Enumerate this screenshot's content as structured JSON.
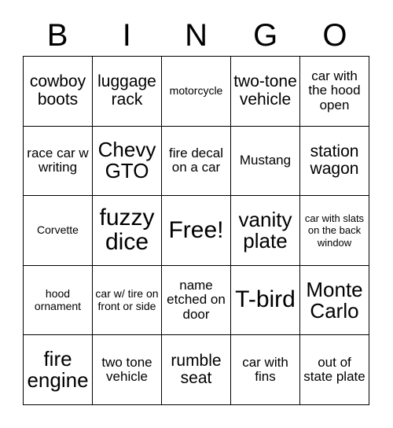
{
  "header": {
    "letters": [
      "B",
      "I",
      "N",
      "G",
      "O"
    ]
  },
  "grid": {
    "rows": 5,
    "columns": 5,
    "free_space_label": "Free!",
    "cells": [
      {
        "text": "cowboy boots",
        "size": "lg"
      },
      {
        "text": "luggage rack",
        "size": "lg"
      },
      {
        "text": "motorcycle",
        "size": "sm"
      },
      {
        "text": "two-tone vehicle",
        "size": "lg"
      },
      {
        "text": "car with the hood open",
        "size": "md"
      },
      {
        "text": "race car w writing",
        "size": "md"
      },
      {
        "text": "Chevy GTO",
        "size": "xl"
      },
      {
        "text": "fire decal on a car",
        "size": "md"
      },
      {
        "text": "Mustang",
        "size": "md"
      },
      {
        "text": "station wagon",
        "size": "lg"
      },
      {
        "text": "Corvette",
        "size": "sm"
      },
      {
        "text": "fuzzy dice",
        "size": "xxl"
      },
      {
        "text": "Free!",
        "size": "xxl"
      },
      {
        "text": "vanity plate",
        "size": "xl"
      },
      {
        "text": "car with slats on the back window",
        "size": "xs"
      },
      {
        "text": "hood ornament",
        "size": "sm"
      },
      {
        "text": "car w/ tire on front or side",
        "size": "sm"
      },
      {
        "text": "name etched on door",
        "size": "md"
      },
      {
        "text": "T-bird",
        "size": "xxl"
      },
      {
        "text": "Monte Carlo",
        "size": "xl"
      },
      {
        "text": "fire engine",
        "size": "xl"
      },
      {
        "text": "two tone vehicle",
        "size": "md"
      },
      {
        "text": "rumble seat",
        "size": "lg"
      },
      {
        "text": "car with fins",
        "size": "md"
      },
      {
        "text": "out of state plate",
        "size": "md"
      }
    ]
  },
  "colors": {
    "background": "#ffffff",
    "text": "#000000",
    "border": "#000000"
  }
}
